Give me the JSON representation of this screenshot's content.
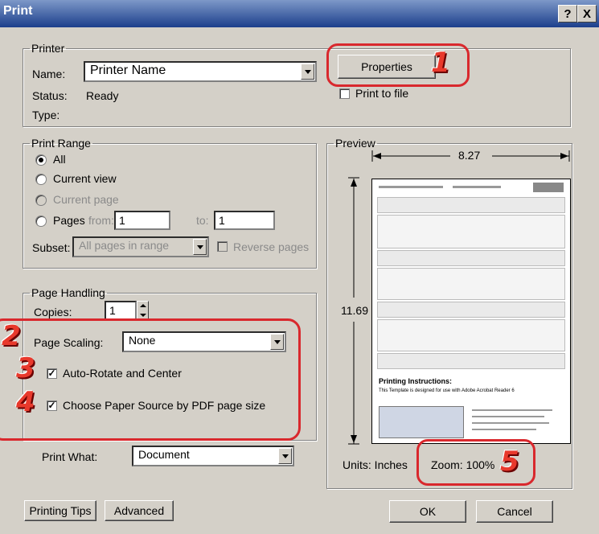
{
  "window": {
    "title": "Print",
    "help_btn": "?",
    "close_btn": "X"
  },
  "printer": {
    "group_label": "Printer",
    "name_label": "Name:",
    "name_value": "Printer Name",
    "status_label": "Status:",
    "status_value": "Ready",
    "type_label": "Type:",
    "properties_label": "Properties",
    "print_to_file_label": "Print to file"
  },
  "print_range": {
    "group_label": "Print Range",
    "all_label": "All",
    "current_view_label": "Current view",
    "current_page_label": "Current page",
    "pages_label": "Pages",
    "from_label": "from:",
    "from_value": "1",
    "to_label": "to:",
    "to_value": "1",
    "subset_label": "Subset:",
    "subset_value": "All pages in range",
    "reverse_label": "Reverse pages"
  },
  "page_handling": {
    "group_label": "Page Handling",
    "copies_label": "Copies:",
    "copies_value": "1",
    "scaling_label": "Page Scaling:",
    "scaling_value": "None",
    "auto_rotate_label": "Auto-Rotate and Center",
    "paper_source_label": "Choose Paper Source by PDF page size"
  },
  "print_what": {
    "label": "Print What:",
    "value": "Document"
  },
  "preview": {
    "group_label": "Preview",
    "width_value": "8.27",
    "height_value": "11.69",
    "units_label": "Units: Inches",
    "zoom_label": "Zoom: 100%",
    "doc_heading": "Printing Instructions:",
    "doc_text": "This Template is designed for use with Adobe Acrobat Reader 6"
  },
  "buttons": {
    "printing_tips": "Printing Tips",
    "advanced": "Advanced",
    "ok": "OK",
    "cancel": "Cancel"
  },
  "callouts": {
    "n1": "1",
    "n2": "2",
    "n3": "3",
    "n4": "4",
    "n5": "5"
  }
}
